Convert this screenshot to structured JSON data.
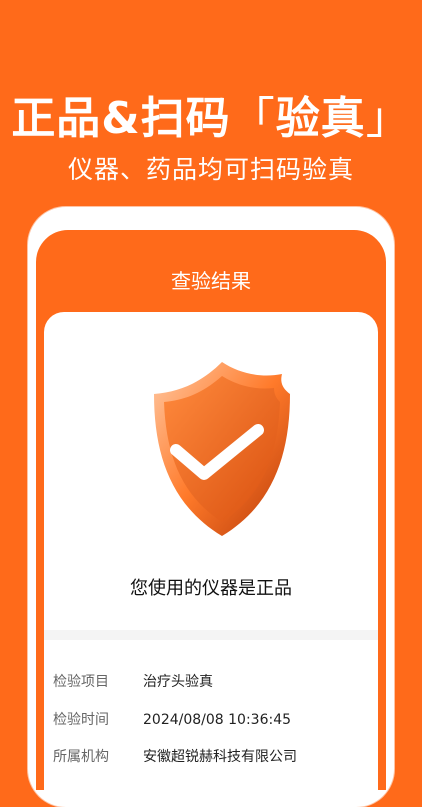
{
  "promo": {
    "headline_main": "正品&扫码",
    "headline_bracket_open": "「",
    "headline_highlight": "验真",
    "headline_bracket_close": "」",
    "subheadline": "仪器、药品均可扫码验真"
  },
  "screen": {
    "title": "查验结果",
    "result_text": "您使用的仪器是正品",
    "shield_icon": "shield-check-icon",
    "details": [
      {
        "label": "检验项目",
        "value": "治疗头验真"
      },
      {
        "label": "检验时间",
        "value": "2024/08/08  10:36:45"
      },
      {
        "label": "所属机构",
        "value": "安徽超锐赫科技有限公司"
      }
    ]
  },
  "colors": {
    "brand": "#FF6A1A",
    "shield_dark": "#C8430E",
    "shield_light": "#FF8A3D"
  }
}
